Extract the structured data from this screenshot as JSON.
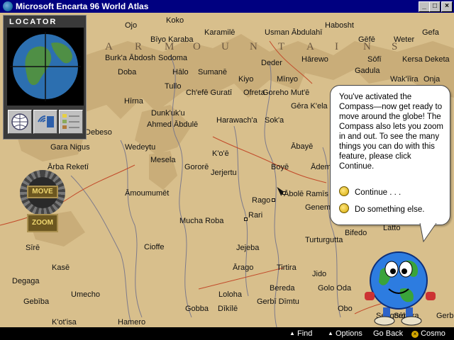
{
  "window": {
    "title": "Microsoft Encarta 96 World Atlas"
  },
  "mountains_label": [
    "A",
    "R",
    "M",
    "O",
    "U",
    "N",
    "T",
    "A",
    "I",
    "N",
    "S"
  ],
  "places": [
    "Ojo",
    "Koko",
    "Karamilē",
    "Usman Ābdulahī",
    "Habosht",
    "Gefa",
    "Bīyo Karaba",
    "Gēfē",
    "Weter",
    "Burk'a Ābdosh",
    "Sodoma",
    "Deder",
    "Hārewo",
    "Sōfī",
    "Kersa Deketa",
    "Doba",
    "Hālo",
    "Sumanē",
    "Kiyo",
    "Mīnyo",
    "Gadula",
    "Wak'īīra",
    "Onja",
    "Tullo",
    "Ofreta",
    "Goreho Mut'ē",
    "Hīrna",
    "Ch'efē Guratī",
    "Gēra K'ela",
    "Dunk'uk'u",
    "Ahmed Ābdulē",
    "Harawach'a",
    "Sok'a",
    "Debeso",
    "Gara Nigus",
    "Wedeytu",
    "K'o'ē",
    "Ābayē",
    "Mesela",
    "Gororē",
    "Jerjertu",
    "Boyē",
    "Ādem",
    "Ārba Reketī",
    "Āmoumumēt",
    "Rago",
    "Ābolē Ramīs",
    "Genemī",
    "Rari",
    "Mucha Roba",
    "Turturgutta",
    "Bifedo",
    "Latto",
    "Cioffe",
    "Jejeba",
    "Sīrē",
    "Kasē",
    "Ārago",
    "Tirtira",
    "Jido",
    "Degaga",
    "Bereda",
    "Golo Oda",
    "Umecho",
    "Loloha",
    "Obo",
    "Gebība",
    "Gobba",
    "Dīkīlē",
    "Gerbī Dīmtu",
    "Hamero",
    "K'ot'isa",
    "Sengoro",
    "Sēbera",
    "Gerbo"
  ],
  "locator": {
    "title": "LOCATOR"
  },
  "controls": {
    "move_label": "MOVE",
    "zoom_label": "ZOOM"
  },
  "callout": {
    "message": "You've activated the Compass—now get ready to move around the globe! The Compass also lets you zoom in and out. To see the many things you can do with this feature, please click Continue.",
    "options": [
      "Continue . . .",
      "Do something else."
    ]
  },
  "bottom_bar": {
    "find": "Find",
    "options": "Options",
    "go_back": "Go Back",
    "cosmo": "Cosmo"
  },
  "colors": {
    "title_bar": "#000080",
    "map_bg": "#d8bf8c",
    "highlands": "#c9ad79",
    "river": "#7d7a8b",
    "road": "#c24a2a"
  },
  "icons": [
    "app-globe-icon",
    "minimize-icon",
    "maximize-icon",
    "close-icon",
    "globe-locator-icon",
    "world-view-icon",
    "radio-waves-icon",
    "legend-icon",
    "move-knob-icon",
    "cosmo-character-icon",
    "triangle-up-icon",
    "cosmo-cursor-icon"
  ]
}
